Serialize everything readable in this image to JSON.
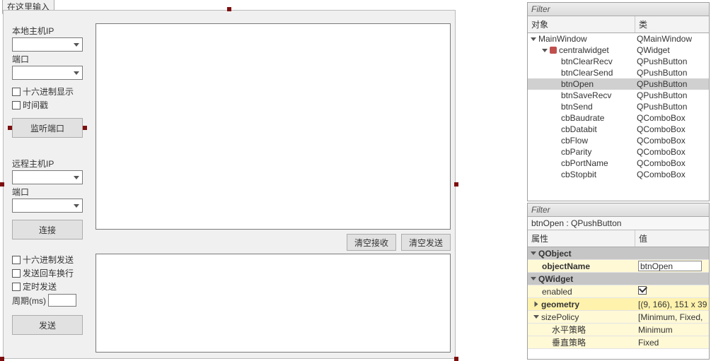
{
  "designer": {
    "tab_stub": "在这里输入",
    "left": {
      "local_ip_label": "本地主机IP",
      "port_label": "端口",
      "hex_display": "十六进制显示",
      "timestamp": "时间戳",
      "listen_btn": "监听端口",
      "remote_ip_label": "远程主机IP",
      "port_label2": "端口",
      "connect_btn": "连接",
      "hex_send": "十六进制发送",
      "send_crlf": "发送回车换行",
      "timed_send": "定时发送",
      "period_label": "周期(ms)",
      "send_btn": "发送"
    },
    "buttons": {
      "clear_recv": "清空接收",
      "clear_send": "清空发送"
    }
  },
  "object_panel": {
    "filter_placeholder": "Filter",
    "col_object": "对象",
    "col_class": "类",
    "rows": [
      {
        "indent": 0,
        "tw": "open",
        "name": "MainWindow",
        "cls": "QMainWindow",
        "icon": ""
      },
      {
        "indent": 1,
        "tw": "open",
        "name": "centralwidget",
        "cls": "QWidget",
        "icon": "dot"
      },
      {
        "indent": 2,
        "tw": "",
        "name": "btnClearRecv",
        "cls": "QPushButton"
      },
      {
        "indent": 2,
        "tw": "",
        "name": "btnClearSend",
        "cls": "QPushButton"
      },
      {
        "indent": 2,
        "tw": "",
        "name": "btnOpen",
        "cls": "QPushButton",
        "sel": true
      },
      {
        "indent": 2,
        "tw": "",
        "name": "btnSaveRecv",
        "cls": "QPushButton"
      },
      {
        "indent": 2,
        "tw": "",
        "name": "btnSend",
        "cls": "QPushButton"
      },
      {
        "indent": 2,
        "tw": "",
        "name": "cbBaudrate",
        "cls": "QComboBox"
      },
      {
        "indent": 2,
        "tw": "",
        "name": "cbDatabit",
        "cls": "QComboBox"
      },
      {
        "indent": 2,
        "tw": "",
        "name": "cbFlow",
        "cls": "QComboBox"
      },
      {
        "indent": 2,
        "tw": "",
        "name": "cbParity",
        "cls": "QComboBox"
      },
      {
        "indent": 2,
        "tw": "",
        "name": "cbPortName",
        "cls": "QComboBox"
      },
      {
        "indent": 2,
        "tw": "",
        "name": "cbStopbit",
        "cls": "QComboBox"
      }
    ]
  },
  "prop_panel": {
    "filter_placeholder": "Filter",
    "object_line": "btnOpen : QPushButton",
    "col_prop": "属性",
    "col_val": "值",
    "groups": {
      "qobject": "QObject",
      "qwidget": "QWidget"
    },
    "props": {
      "objectName_k": "objectName",
      "objectName_v": "btnOpen",
      "enabled_k": "enabled",
      "geometry_k": "geometry",
      "geometry_v": "[(9, 166), 151 x 39",
      "sizePolicy_k": "sizePolicy",
      "sizePolicy_v": "[Minimum, Fixed,",
      "hpolicy_k": "水平策略",
      "hpolicy_v": "Minimum",
      "vpolicy_k": "垂直策略",
      "vpolicy_v": "Fixed"
    }
  }
}
